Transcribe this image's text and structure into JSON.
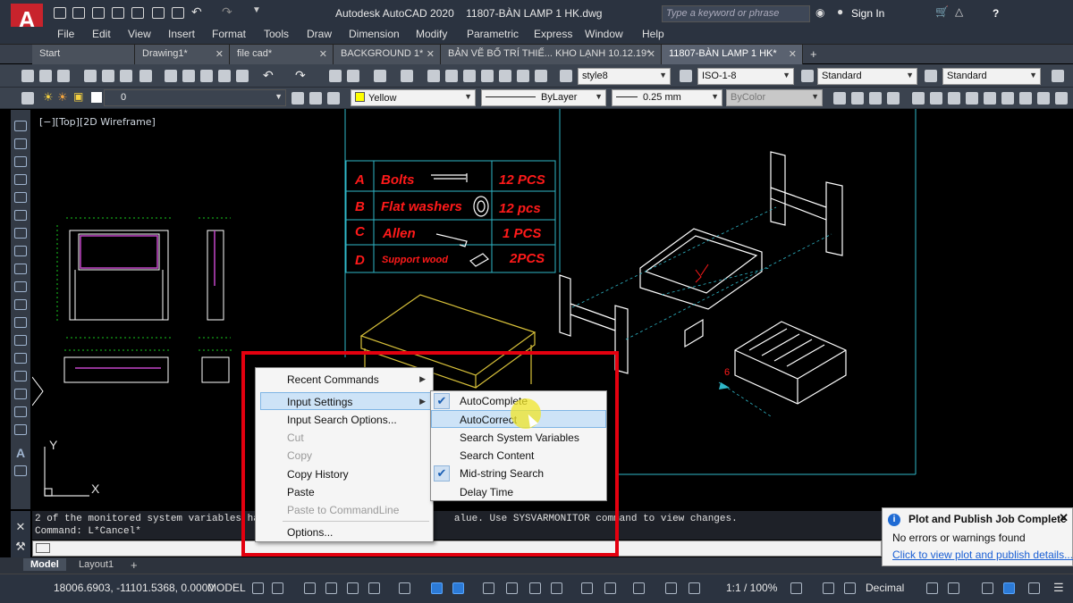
{
  "app": {
    "logo_letter": "A",
    "title": "Autodesk AutoCAD 2020",
    "file": "11807-BÀN LAMP 1 HK.dwg",
    "search_placeholder": "Type a keyword or phrase",
    "sign_in": "Sign In"
  },
  "menu": [
    "File",
    "Edit",
    "View",
    "Insert",
    "Format",
    "Tools",
    "Draw",
    "Dimension",
    "Modify",
    "Parametric",
    "Express",
    "Window",
    "Help"
  ],
  "tabs": [
    {
      "label": "Start",
      "closable": false
    },
    {
      "label": "Drawing1*",
      "closable": true
    },
    {
      "label": "file cad*",
      "closable": true
    },
    {
      "label": "BACKGROUND 1*",
      "closable": true
    },
    {
      "label": "BẢN VẼ BỐ TRÍ THIẾ... KHO LẠNH 10.12.19*",
      "closable": true
    },
    {
      "label": "11807-BÀN LAMP 1 HK*",
      "closable": true,
      "active": true
    }
  ],
  "toolbar": {
    "text_style": "style8",
    "dim_style": "ISO-1-8",
    "table_style": "Standard",
    "mleader_style": "Standard",
    "layer": "0",
    "color": "Yellow",
    "color_hex": "#ffff00",
    "linetype": "ByLayer",
    "lineweight": "0.25 mm",
    "plot_style": "ByColor"
  },
  "viewport_label": "[−][Top][2D Wireframe]",
  "drawing": {
    "bom_rows": [
      {
        "key": "A",
        "name": "Bolts",
        "qty": "12 PCS"
      },
      {
        "key": "B",
        "name": "Flat washers",
        "qty": "12 pcs"
      },
      {
        "key": "C",
        "name": "Allen",
        "qty": "1 PCS"
      },
      {
        "key": "D",
        "name": "Support wood",
        "qty": "2PCS"
      }
    ],
    "ucs_y": "Y",
    "ucs_x": "X",
    "marker_6": "6"
  },
  "command_line": {
    "history_line1": "2 of the monitored system variables ha",
    "history_line1_end": "alue. Use SYSVARMONITOR command to view changes.",
    "history_line2": "Command: L*Cancel*"
  },
  "context_menu": {
    "items": [
      {
        "label": "Recent Commands",
        "submenu": true,
        "enabled": true
      },
      {
        "label": "Input Settings",
        "submenu": true,
        "enabled": true,
        "highlight": true
      },
      {
        "label": "Input Search Options...",
        "enabled": true
      },
      {
        "label": "Cut",
        "enabled": false
      },
      {
        "label": "Copy",
        "enabled": false
      },
      {
        "label": "Copy History",
        "enabled": true
      },
      {
        "label": "Paste",
        "enabled": true
      },
      {
        "label": "Paste to CommandLine",
        "enabled": false
      },
      {
        "label": "Options...",
        "enabled": true
      }
    ]
  },
  "submenu": {
    "items": [
      {
        "label": "AutoComplete",
        "checked": true
      },
      {
        "label": "AutoCorrect",
        "checked": false,
        "highlight": true
      },
      {
        "label": "Search System Variables",
        "checked": false
      },
      {
        "label": "Search Content",
        "checked": false
      },
      {
        "label": "Mid-string Search",
        "checked": true
      },
      {
        "label": "Delay Time",
        "checked": false
      }
    ]
  },
  "layout_tabs": [
    "Model",
    "Layout1"
  ],
  "statusbar": {
    "coords": "18006.6903, -11101.5368, 0.0000",
    "model": "MODEL",
    "scale": "1:1 / 100%",
    "units": "Decimal"
  },
  "notification": {
    "title": "Plot and Publish Job Complete",
    "message": "No errors or warnings found",
    "link": "Click to view plot and publish details..."
  },
  "colors": {
    "annotation_red": "#e4000f",
    "cad_cyan": "#2fb7c8",
    "cad_magenta": "#c246c8",
    "cad_green": "#19c81e",
    "cad_red_text": "#ff1a1a",
    "cad_yellow": "#d9c23a"
  }
}
